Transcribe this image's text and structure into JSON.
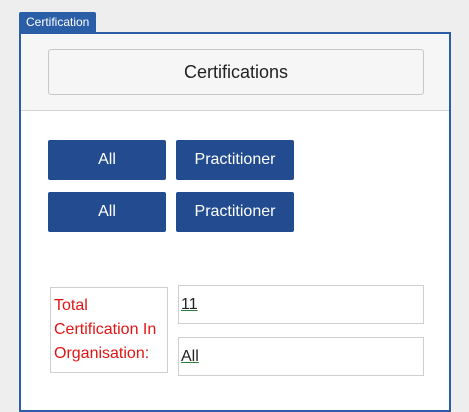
{
  "panel": {
    "tab_label": "Certification"
  },
  "header": {
    "title": "Certifications"
  },
  "filters": {
    "row1": {
      "left": "All",
      "right": "Practitioner"
    },
    "row2": {
      "left": "All",
      "right": "Practitioner"
    }
  },
  "summary": {
    "label": "Total Certification In Organisation:",
    "value": "11",
    "scope": "All"
  },
  "colors": {
    "accent": "#2a5ea6",
    "button": "#224c8f",
    "label_text": "#e11414"
  }
}
